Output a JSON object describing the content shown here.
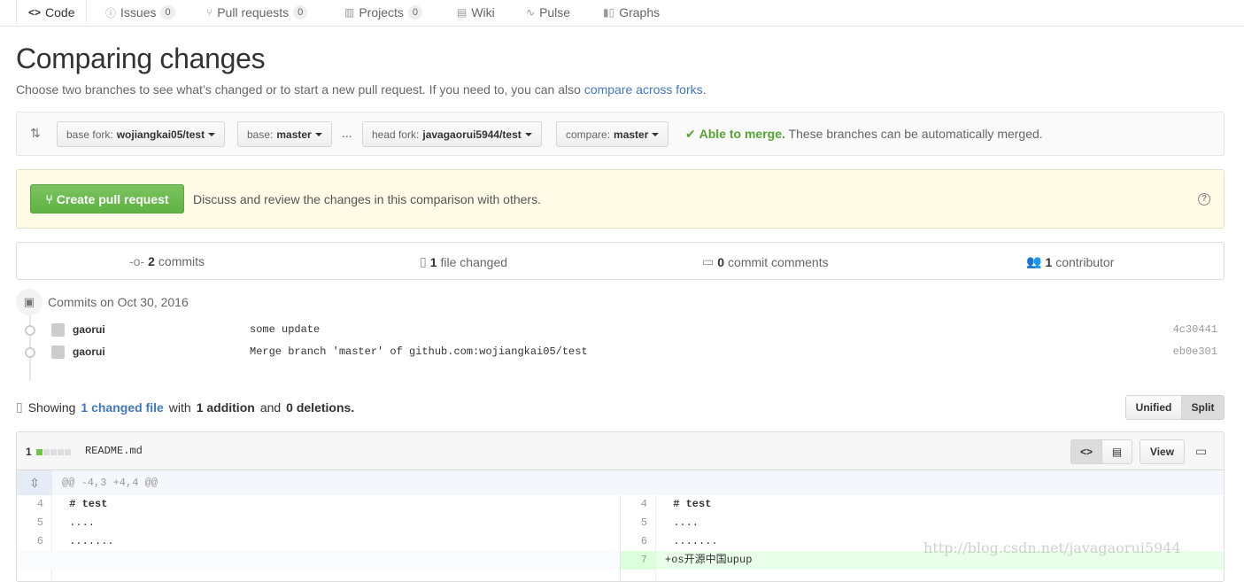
{
  "tabs": [
    {
      "label": "Code",
      "icon": "code-icon"
    },
    {
      "label": "Issues",
      "count": "0",
      "icon": "issue-icon"
    },
    {
      "label": "Pull requests",
      "count": "0",
      "icon": "pull-request-icon"
    },
    {
      "label": "Projects",
      "count": "0",
      "icon": "project-icon"
    },
    {
      "label": "Wiki",
      "icon": "book-icon"
    },
    {
      "label": "Pulse",
      "icon": "pulse-icon"
    },
    {
      "label": "Graphs",
      "icon": "graph-icon"
    }
  ],
  "page": {
    "title": "Comparing changes",
    "subtitle_prefix": "Choose two branches to see what’s changed or to start a new pull request. If you need to, you can also",
    "subtitle_link": "compare across forks",
    "subtitle_suffix": "."
  },
  "range": {
    "base_fork_label": "base fork:",
    "base_fork_value": "wojiangkai05/test",
    "base_label": "base:",
    "base_value": "master",
    "ellipsis": "...",
    "head_fork_label": "head fork:",
    "head_fork_value": "javagaorui5944/test",
    "compare_label": "compare:",
    "compare_value": "master",
    "merge_status": "Able to merge.",
    "merge_message": "These branches can be automatically merged."
  },
  "create_pr": {
    "button": "Create pull request",
    "text": "Discuss and review the changes in this comparison with others.",
    "help": "?"
  },
  "summary": {
    "commits_count": "2",
    "commits_label": "commits",
    "files_count": "1",
    "files_label": "file changed",
    "comments_count": "0",
    "comments_label": "commit comments",
    "contributors_count": "1",
    "contributors_label": "contributor"
  },
  "commits": {
    "date_heading": "Commits on Oct 30, 2016",
    "items": [
      {
        "author": "gaorui",
        "message": "some update",
        "sha": "4c30441"
      },
      {
        "author": "gaorui",
        "message": "Merge branch 'master' of github.com:wojiangkai05/test",
        "sha": "eb0e301"
      }
    ]
  },
  "files_summary": {
    "showing": "Showing",
    "changed_link": "1 changed file",
    "with": "with",
    "additions": "1 addition",
    "and": "and",
    "deletions": "0 deletions",
    "period": "."
  },
  "view_toggle": {
    "unified": "Unified",
    "split": "Split",
    "selected": "Split"
  },
  "file": {
    "stat_count": "1",
    "stat_blocks": [
      "add",
      "neutral",
      "neutral",
      "neutral",
      "neutral"
    ],
    "name": "README.md",
    "view_button": "View",
    "hunk_header": "@@ -4,3 +4,4 @@",
    "left_lines": [
      {
        "num": "4",
        "code": " # test"
      },
      {
        "num": "5",
        "code": " ...."
      },
      {
        "num": "6",
        "code": " ......."
      }
    ],
    "right_lines": [
      {
        "num": "4",
        "code": " # test"
      },
      {
        "num": "5",
        "code": " ...."
      },
      {
        "num": "6",
        "code": " ......."
      },
      {
        "num": "7",
        "code": "+os开源中国upup"
      }
    ]
  },
  "colors": {
    "accent_tab": "#d26911",
    "link": "#4078c0",
    "merge_ok": "#55a532",
    "button_green": "#5fb243",
    "addition_bg": "#eaffea",
    "addition_num_bg": "#dbffdb"
  },
  "watermark": "http://blog.csdn.net/javagaorui5944"
}
